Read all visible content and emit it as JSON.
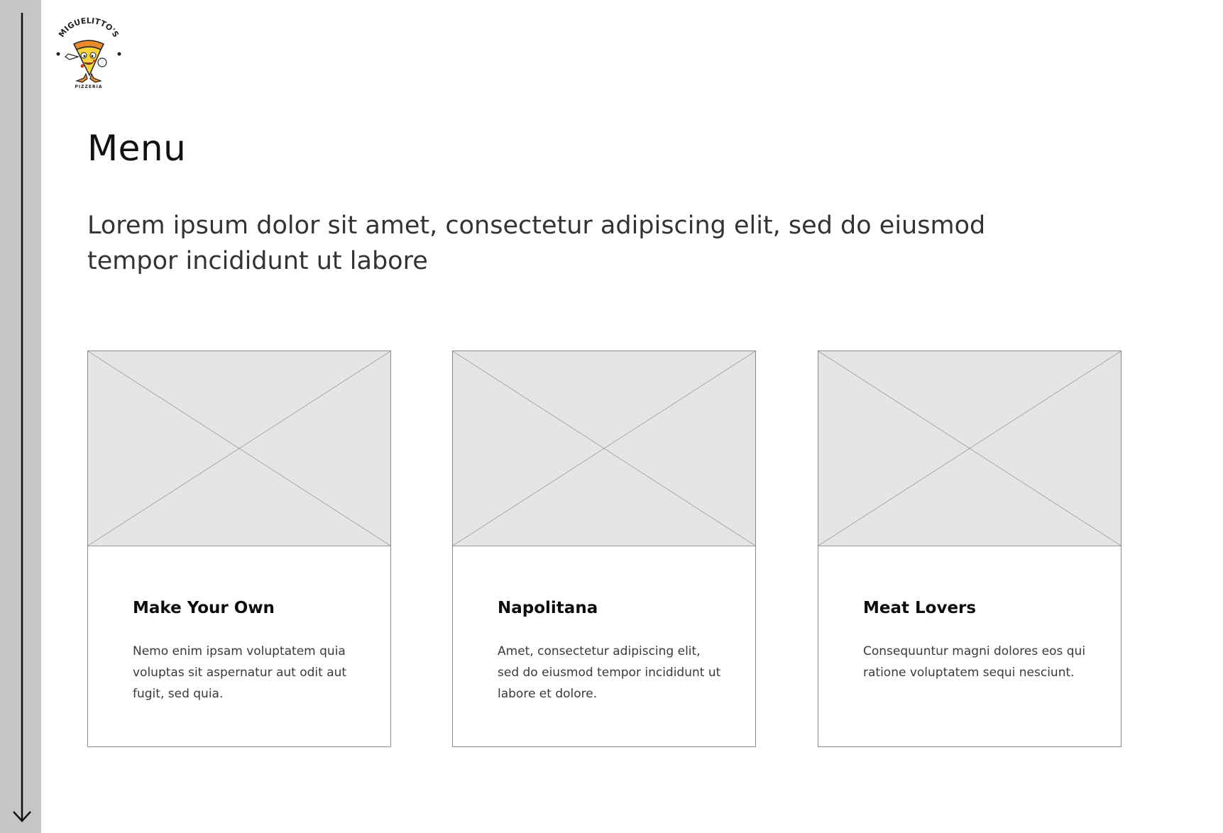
{
  "brand": {
    "name": "MIGUELITTO'S",
    "tagline": "PIZZERIA",
    "colors": {
      "crust": "#e8892b",
      "cheese": "#f5d33a",
      "ink": "#222222"
    }
  },
  "header": {
    "title": "Menu",
    "lead": "Lorem ipsum dolor sit amet, consectetur adipiscing elit, sed do eiusmod tempor incididunt ut labore"
  },
  "menu": {
    "items": [
      {
        "name": "Make Your Own",
        "description": "Nemo enim ipsam voluptatem quia voluptas sit aspernatur aut odit aut fugit, sed quia."
      },
      {
        "name": "Napolitana",
        "description": "Amet, consectetur adipiscing elit, sed do eiusmod tempor incididunt ut labore et dolore."
      },
      {
        "name": "Meat Lovers",
        "description": "Consequuntur magni dolores eos qui ratione voluptatem sequi nesciunt."
      }
    ]
  },
  "icons": {
    "scroll": "arrow-down-icon",
    "placeholder": "image-placeholder-icon"
  },
  "colors": {
    "rail": "#c6c6c6",
    "placeholder_fill": "#e5e5e5",
    "card_border": "#8a8a8a"
  }
}
